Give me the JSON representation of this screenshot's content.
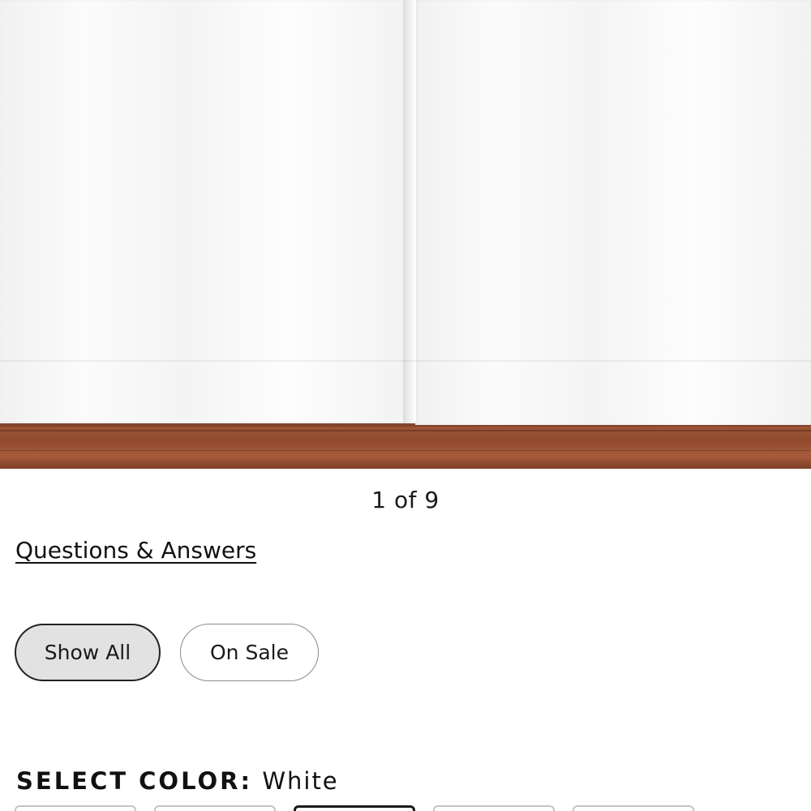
{
  "gallery": {
    "counter": "1 of 9"
  },
  "links": {
    "qa": "Questions & Answers"
  },
  "filters": [
    {
      "label": "Show All",
      "selected": true
    },
    {
      "label": "On Sale",
      "selected": false
    }
  ],
  "color_selector": {
    "label": "SELECT COLOR:",
    "value": "White",
    "selected_swatch": 3,
    "swatch_count": 5
  }
}
